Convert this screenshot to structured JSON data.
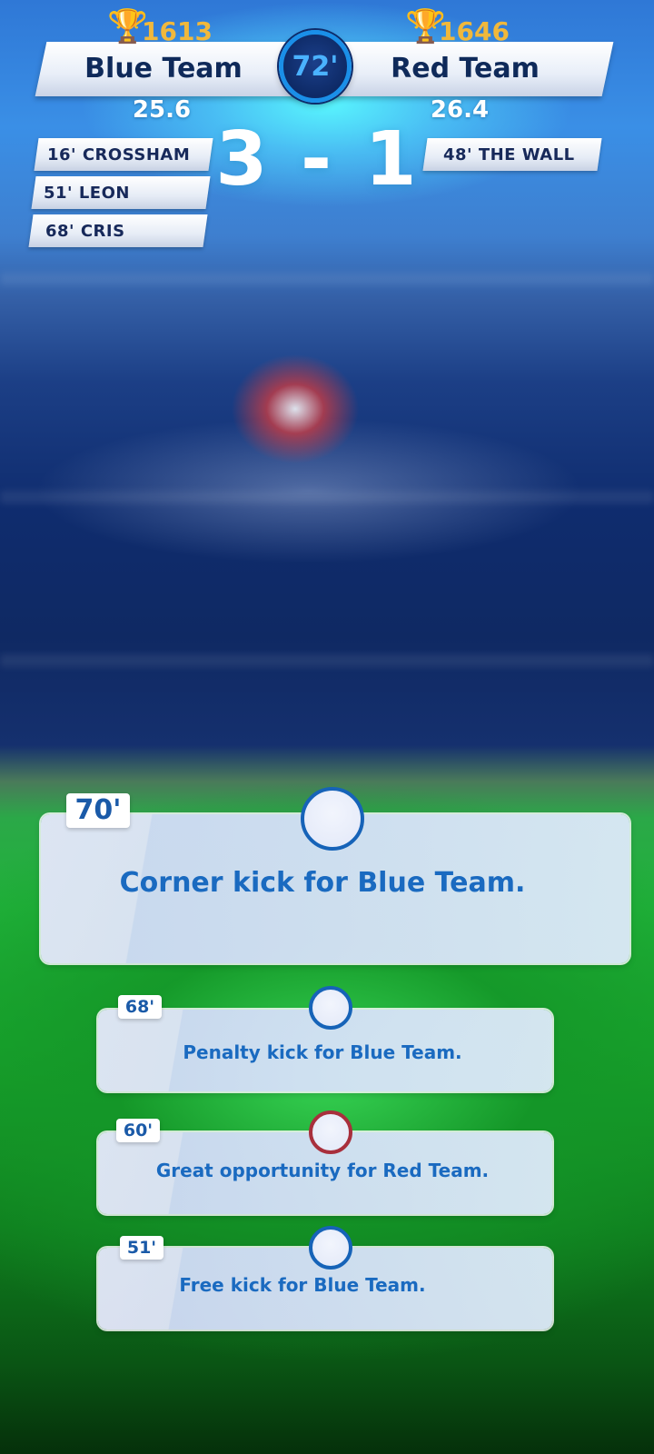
{
  "match": {
    "minute": "72'",
    "score": "3 - 1",
    "home": {
      "name": "Blue Team",
      "trophy_points": "1613",
      "rating": "25.6",
      "scorers": [
        "16' CROSSHAM",
        "51' LEON",
        "68' CRIS"
      ]
    },
    "away": {
      "name": "Red Team",
      "trophy_points": "1646",
      "rating": "26.4",
      "scorers": [
        "48' THE WALL"
      ]
    }
  },
  "events": [
    {
      "time": "70'",
      "text": "Corner kick for Blue Team.",
      "team": "blue"
    },
    {
      "time": "68'",
      "text": "Penalty kick for Blue Team.",
      "team": "blue"
    },
    {
      "time": "60'",
      "text": "Great opportunity for Red Team.",
      "team": "red"
    },
    {
      "time": "51'",
      "text": "Free kick for Blue Team.",
      "team": "blue"
    }
  ],
  "icons": {
    "trophy": "trophy-icon",
    "event_blue": "blue-team-event-icon",
    "event_red": "red-team-event-icon"
  },
  "colors": {
    "home": "#1663b8",
    "away": "#a82f3c",
    "trophy": "#f0b83c",
    "timer_ring": "#1a8fe8"
  }
}
